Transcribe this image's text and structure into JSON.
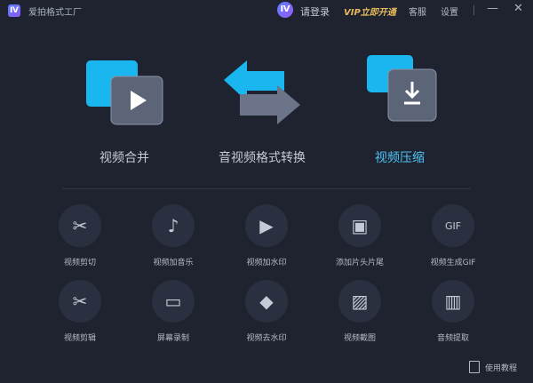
{
  "app": {
    "logo": "Ⅳ",
    "title": "爱拍格式工厂"
  },
  "header": {
    "avatar": "Ⅳ",
    "login": "请登录",
    "vip": "VIP立即开通",
    "service": "客服",
    "settings": "设置",
    "minimize": "—",
    "close": "✕"
  },
  "features": [
    {
      "label": "视频合并",
      "icon": "video-merge-icon",
      "color": "#c5cad6"
    },
    {
      "label": "音视频格式转换",
      "icon": "format-convert-icon",
      "color": "#c5cad6"
    },
    {
      "label": "视频压缩",
      "icon": "video-compress-icon",
      "color": "#4cc3f5"
    }
  ],
  "tools": [
    {
      "label": "视频剪切",
      "icon": "✂"
    },
    {
      "label": "视频加音乐",
      "icon": "♪"
    },
    {
      "label": "视频加水印",
      "icon": "▶"
    },
    {
      "label": "添加片头片尾",
      "icon": "▣"
    },
    {
      "label": "视频生成GIF",
      "icon": "GIF"
    },
    {
      "label": "视频剪辑",
      "icon": "✂"
    },
    {
      "label": "屏幕录制",
      "icon": "▭"
    },
    {
      "label": "视频去水印",
      "icon": "◆"
    },
    {
      "label": "视频截图",
      "icon": "▨"
    },
    {
      "label": "音频提取",
      "icon": "▥"
    }
  ],
  "footer": {
    "help": "使用教程"
  }
}
